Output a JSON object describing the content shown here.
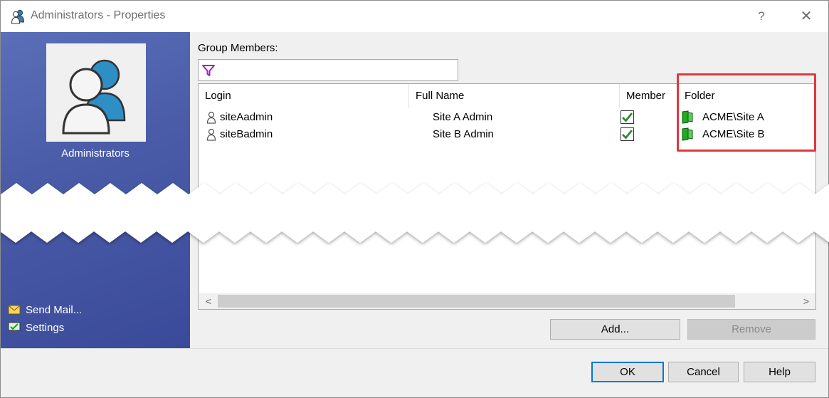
{
  "window": {
    "title": "Administrators - Properties",
    "help_glyph": "?",
    "close_glyph": "✕"
  },
  "group": {
    "name": "Administrators",
    "icon": "group-users-icon"
  },
  "sidebar": {
    "links": [
      {
        "label": "Send Mail...",
        "icon": "envelope-icon"
      },
      {
        "label": "Settings",
        "icon": "settings-monitor-icon"
      }
    ]
  },
  "members": {
    "label": "Group Members:",
    "filter": {
      "value": "",
      "placeholder": "",
      "icon": "funnel-icon"
    },
    "columns": [
      "Login",
      "Full Name",
      "Member",
      "Folder"
    ],
    "rows": [
      {
        "login": "siteAadmin",
        "full_name": "Site A Admin",
        "member": true,
        "folder": "ACME\\Site A"
      },
      {
        "login": "siteBadmin",
        "full_name": "Site B Admin",
        "member": true,
        "folder": "ACME\\Site B"
      }
    ],
    "scroll_left": "<",
    "scroll_right": ">"
  },
  "buttons": {
    "add": "Add...",
    "remove": "Remove",
    "ok": "OK",
    "cancel": "Cancel",
    "help": "Help"
  },
  "colors": {
    "panel_blue": "#4a5ca8",
    "highlight_red": "#e0383e",
    "check_green": "#2e8b2e",
    "folder_green": "#22aa22"
  }
}
